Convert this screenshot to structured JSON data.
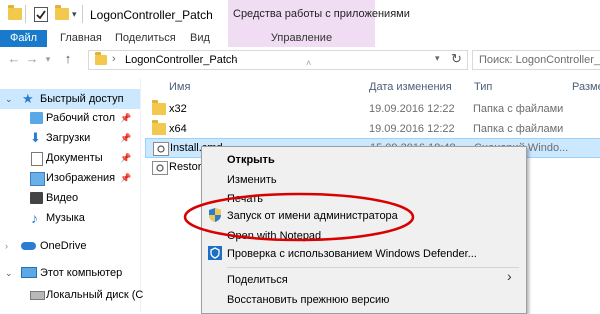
{
  "title_bar": {
    "window_title": "LogonController_Patch",
    "contextual_header": "Средства работы с приложениями"
  },
  "ribbon": {
    "tabs": [
      "Файл",
      "Главная",
      "Поделиться",
      "Вид"
    ],
    "contextual_tab": "Управление"
  },
  "address": {
    "path_label": "LogonController_Patch",
    "search_placeholder": "Поиск: LogonController_Patch"
  },
  "nav_pane": {
    "quick_access": "Быстрый доступ",
    "items": [
      {
        "label": "Рабочий стол",
        "pinned": true
      },
      {
        "label": "Загрузки",
        "pinned": true
      },
      {
        "label": "Документы",
        "pinned": true
      },
      {
        "label": "Изображения",
        "pinned": true
      },
      {
        "label": "Видео",
        "pinned": false
      },
      {
        "label": "Музыка",
        "pinned": false
      }
    ],
    "onedrive": "OneDrive",
    "this_pc": "Этот компьютер",
    "local_disk": "Локальный диск (С"
  },
  "columns": {
    "name": "Имя",
    "date": "Дата изменения",
    "type": "Тип",
    "size": "Разме"
  },
  "files": [
    {
      "name": "x32",
      "date": "19.09.2016 12:22",
      "type": "Папка с файлами",
      "kind": "folder"
    },
    {
      "name": "x64",
      "date": "19.09.2016 12:22",
      "type": "Папка с файлами",
      "kind": "folder"
    },
    {
      "name": "Install.cmd",
      "date": "15.09.2016 18:48",
      "type": "Сценарий Windo...",
      "kind": "cmd"
    },
    {
      "name": "Restore",
      "date": "",
      "type": "",
      "kind": "cmd"
    }
  ],
  "context_menu": {
    "open": "Открыть",
    "edit": "Изменить",
    "print": "Печать",
    "run_as_admin": "Запуск от имени администратора",
    "open_notepad": "Open with Notepad",
    "defender": "Проверка с использованием Windows Defender...",
    "share": "Поделиться",
    "restore": "Восстановить прежнюю версию"
  },
  "colors": {
    "file_tab": "#1979ca",
    "contextual": "#f0ddf3",
    "selection": "#cce8ff",
    "annotation": "#d90000"
  },
  "icons": {
    "pin": "📌",
    "chevron_right": "›"
  }
}
